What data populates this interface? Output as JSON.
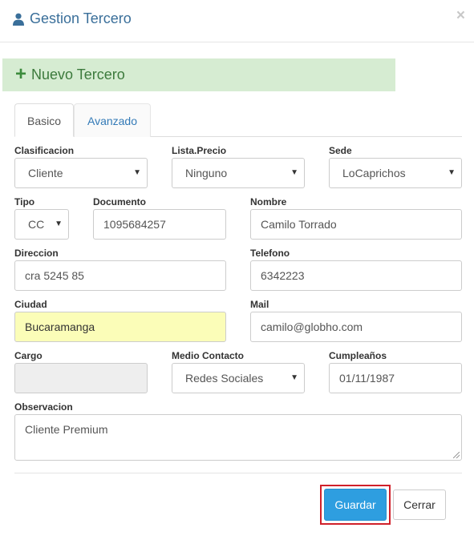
{
  "header": {
    "title": "Gestion Tercero",
    "close_symbol": "×"
  },
  "banner": {
    "icon": "plus-icon",
    "title": "Nuevo Tercero"
  },
  "tabs": [
    {
      "label": "Basico",
      "active": true
    },
    {
      "label": "Avanzado",
      "active": false
    }
  ],
  "form": {
    "clasificacion": {
      "label": "Clasificacion",
      "value": "Cliente"
    },
    "lista_precio": {
      "label": "Lista.Precio",
      "value": "Ninguno"
    },
    "sede": {
      "label": "Sede",
      "value": "LoCaprichos"
    },
    "tipo": {
      "label": "Tipo",
      "value": "CC"
    },
    "documento": {
      "label": "Documento",
      "value": "1095684257"
    },
    "nombre": {
      "label": "Nombre",
      "value": "Camilo Torrado"
    },
    "direccion": {
      "label": "Direccion",
      "value": "cra 5245 85"
    },
    "telefono": {
      "label": "Telefono",
      "value": "6342223"
    },
    "ciudad": {
      "label": "Ciudad",
      "value": "Bucaramanga"
    },
    "mail": {
      "label": "Mail",
      "value": "camilo@globho.com"
    },
    "cargo": {
      "label": "Cargo",
      "value": ""
    },
    "medio_contacto": {
      "label": "Medio Contacto",
      "value": "Redes Sociales"
    },
    "cumpleanos": {
      "label": "Cumpleaños",
      "value": "01/11/1987"
    },
    "observacion": {
      "label": "Observacion",
      "value": "Cliente Premium"
    }
  },
  "footer": {
    "save_label": "Guardar",
    "close_label": "Cerrar"
  },
  "colors": {
    "accent": "#2e9ee0",
    "banner_bg": "#d6ecd2",
    "highlight_field": "#fbfdb8",
    "callout_border": "#d0202a"
  }
}
